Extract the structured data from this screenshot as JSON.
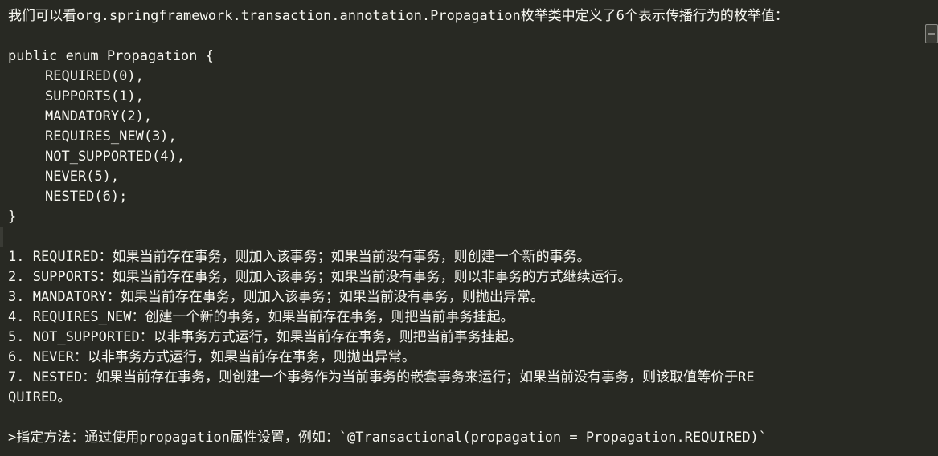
{
  "editor": {
    "top_fragment": "",
    "intro_line": "我们可以看org.springframework.transaction.annotation.Propagation枚举类中定义了6个表示传播行为的枚举值：",
    "code": {
      "open": "public enum Propagation {",
      "entries": [
        "REQUIRED(0),",
        "SUPPORTS(1),",
        "MANDATORY(2),",
        "REQUIRES_NEW(3),",
        "NOT_SUPPORTED(4),",
        "NEVER(5),",
        "NESTED(6);"
      ],
      "close": "}"
    },
    "list": [
      "1. REQUIRED：如果当前存在事务，则加入该事务；如果当前没有事务，则创建一个新的事务。",
      "2. SUPPORTS：如果当前存在事务，则加入该事务；如果当前没有事务，则以非事务的方式继续运行。",
      "3. MANDATORY：如果当前存在事务，则加入该事务；如果当前没有事务，则抛出异常。",
      "4. REQUIRES_NEW：创建一个新的事务，如果当前存在事务，则把当前事务挂起。",
      "5. NOT_SUPPORTED：以非事务方式运行，如果当前存在事务，则把当前事务挂起。",
      "6. NEVER：以非事务方式运行，如果当前存在事务，则抛出异常。",
      "7. NESTED：如果当前存在事务，则创建一个事务作为当前事务的嵌套事务来运行；如果当前没有事务，则该取值等价于RE"
    ],
    "list_wrap": "QUIRED。",
    "note": ">指定方法：通过使用propagation属性设置，例如：`@Transactional(propagation = Propagation.REQUIRED)`"
  },
  "colors": {
    "background": "#282923",
    "text": "#f8f8f2",
    "gutter_mark": "#3a3b35"
  }
}
